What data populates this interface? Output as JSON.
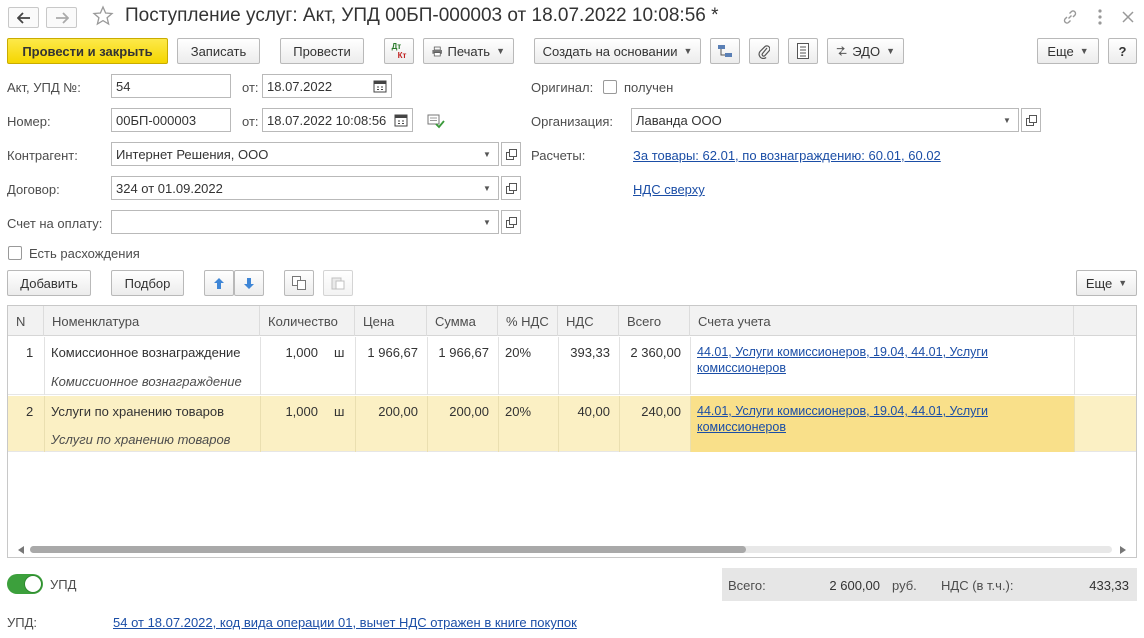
{
  "window": {
    "title": "Поступление услуг: Акт, УПД 00БП-000003 от 18.07.2022 10:08:56 *"
  },
  "toolbar": {
    "post_close": "Провести и закрыть",
    "save": "Записать",
    "post": "Провести",
    "dtkt_top": "Дт",
    "dtkt_bottom": "Кт",
    "print": "Печать",
    "create_based": "Создать на основании",
    "edo": "ЭДО",
    "more": "Еще",
    "help": "?"
  },
  "form": {
    "act_label": "Акт, УПД №:",
    "act_value": "54",
    "from_label": "от:",
    "act_date": "18.07.2022",
    "number_label": "Номер:",
    "number_value": "00БП-000003",
    "number_from_label": "от:",
    "number_date": "18.07.2022 10:08:56",
    "contractor_label": "Контрагент:",
    "contractor_value": "Интернет Решения, ООО",
    "contract_label": "Договор:",
    "contract_value": "324 от 01.09.2022",
    "invoice_label": "Счет на оплату:",
    "invoice_value": "",
    "discrepancy_label": "Есть расхождения",
    "original_label": "Оригинал:",
    "received_label": "получен",
    "org_label": "Организация:",
    "org_value": "Лаванда ООО",
    "settlements_label": "Расчеты:",
    "settlements_link": "За товары: 62.01, по вознаграждению: 60.01, 60.02",
    "vat_link": "НДС сверху"
  },
  "table_toolbar": {
    "add": "Добавить",
    "pick": "Подбор",
    "more": "Еще"
  },
  "table": {
    "headers": [
      "N",
      "Номенклатура",
      "Количество",
      "Цена",
      "Сумма",
      "% НДС",
      "НДС",
      "Всего",
      "Счета учета"
    ],
    "rows": [
      {
        "n": "1",
        "name": "Комиссионное вознаграждение",
        "name_sub": "Комиссионное вознаграждение",
        "qty": "1,000",
        "unit": "ш",
        "price": "1 966,67",
        "sum": "1 966,67",
        "vat_rate": "20%",
        "vat": "393,33",
        "total": "2 360,00",
        "accounts_line1": "44.01, Услуги комиссионеров, 19.04, 44.01, Услуги",
        "accounts_line2": "комиссионеров"
      },
      {
        "n": "2",
        "name": "Услуги по хранению товаров",
        "name_sub": "Услуги по хранению товаров",
        "qty": "1,000",
        "unit": "ш",
        "price": "200,00",
        "sum": "200,00",
        "vat_rate": "20%",
        "vat": "40,00",
        "total": "240,00",
        "accounts_line1": "44.01, Услуги комиссионеров, 19.04, 44.01, Услуги",
        "accounts_line2": "комиссионеров"
      }
    ]
  },
  "footer": {
    "upd_toggle_label": "УПД",
    "total_label": "Всего:",
    "total_value": "2 600,00",
    "currency": "руб.",
    "vat_label": "НДС (в т.ч.):",
    "vat_value": "433,33",
    "upd_label": "УПД:",
    "upd_link": "54 от 18.07.2022, код вида операции 01, вычет НДС отражен в книге покупок"
  },
  "colors": {
    "primary_button": "#f5d600",
    "selected_row": "#fbf0c4",
    "selected_cell": "#f9e08a",
    "link": "#1b4ea6",
    "toggle_on": "#3ca03c"
  }
}
